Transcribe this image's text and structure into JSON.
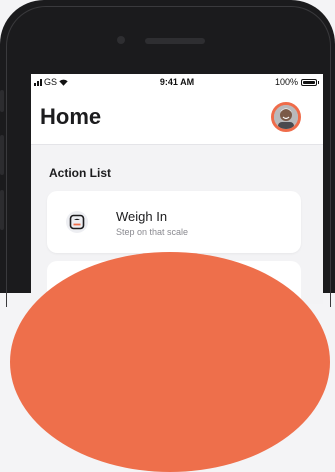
{
  "status_bar": {
    "carrier": "GS",
    "time": "9:41 AM",
    "battery": "100%",
    "battery_level": 1.0
  },
  "header": {
    "title": "Home"
  },
  "actions": {
    "section_title": "Action List",
    "items": [
      {
        "title": "Weigh In",
        "subtitle": "Step on that scale",
        "icon": "scale-icon"
      }
    ]
  },
  "colors": {
    "accent": "#ee6f4b",
    "phone_frame": "#1b1b1d",
    "background": "#f3f3f5"
  }
}
